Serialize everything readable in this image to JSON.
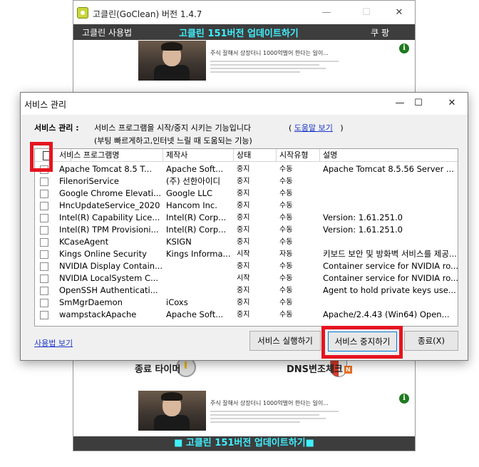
{
  "bg_window": {
    "title": "고클린(GoClean) 버전 1.4.7",
    "menu_left": "고클린 사용법",
    "menu_center": "고클린 151버전 업데이트하기",
    "menu_right": "쿠 팡",
    "ad_text": "주식 잘해서 상장더니 1000억벌어 한다는 일이...",
    "ad_info": "i",
    "timer_label": "종료 타이머",
    "dns_label": "DNS변조체크",
    "dns_badge": "N",
    "bottom_bar": "■ 고클린 151버전 업데이트하기■",
    "minimize": "—",
    "maximize": "☐",
    "close": "✕"
  },
  "dialog": {
    "title": "서비스 관리",
    "minimize": "—",
    "maximize": "☐",
    "close": "✕",
    "header_label": "서비스 관리 :",
    "desc1": "서비스 프로그램을 시작/중지 시키는 기능입니다",
    "desc2": "(부팅 빠르게하고,인터넷 느릴 때 도움되는 기능)",
    "help_open": "(",
    "help_link": "도움말 보기",
    "help_close": ")",
    "columns": [
      "서비스 프로그램명",
      "제작사",
      "상태",
      "시작유형",
      "설명"
    ],
    "rows": [
      {
        "name": "Apache Tomcat 8.5 T...",
        "vendor": "Apache Soft...",
        "status": "중지",
        "start": "수동",
        "desc": "Apache Tomcat 8.5.56 Server ..."
      },
      {
        "name": "FilenoriService",
        "vendor": "(주) 선한아이디",
        "status": "중지",
        "start": "수동",
        "desc": ""
      },
      {
        "name": "Google Chrome Elevati...",
        "vendor": "Google LLC",
        "status": "중지",
        "start": "수동",
        "desc": ""
      },
      {
        "name": "HncUpdateService_2020",
        "vendor": "Hancom Inc.",
        "status": "중지",
        "start": "수동",
        "desc": ""
      },
      {
        "name": "Intel(R) Capability Lice...",
        "vendor": "Intel(R) Corp...",
        "status": "중지",
        "start": "수동",
        "desc": "Version: 1.61.251.0"
      },
      {
        "name": "Intel(R) TPM Provisioni...",
        "vendor": "Intel(R) Corp...",
        "status": "중지",
        "start": "수동",
        "desc": "Version: 1.61.251.0"
      },
      {
        "name": "KCaseAgent",
        "vendor": "KSIGN",
        "status": "중지",
        "start": "수동",
        "desc": ""
      },
      {
        "name": "Kings Online Security",
        "vendor": "Kings Informa...",
        "status": "시작",
        "start": "자동",
        "desc": "키보드 보안 및 방화벽 서비스를 제공..."
      },
      {
        "name": "NVIDIA Display Contain...",
        "vendor": "",
        "status": "중지",
        "start": "수동",
        "desc": "Container service for NVIDIA ro..."
      },
      {
        "name": "NVIDIA LocalSystem C...",
        "vendor": "",
        "status": "시작",
        "start": "수동",
        "desc": "Container service for NVIDIA ro..."
      },
      {
        "name": "OpenSSH Authenticati...",
        "vendor": "",
        "status": "중지",
        "start": "수동",
        "desc": "Agent to hold private keys use..."
      },
      {
        "name": "SmMgrDaemon",
        "vendor": "iCoxs",
        "status": "중지",
        "start": "수동",
        "desc": ""
      },
      {
        "name": "wampstackApache",
        "vendor": "Apache Soft...",
        "status": "중지",
        "start": "수동",
        "desc": "Apache/2.4.43 (Win64) Open..."
      }
    ],
    "btn_start": "서비스 실행하기",
    "btn_stop": "서비스 중지하기",
    "btn_exit": "종료(X)",
    "usage_link": "사용법 보기",
    "highlight_color": "#e5141e"
  }
}
